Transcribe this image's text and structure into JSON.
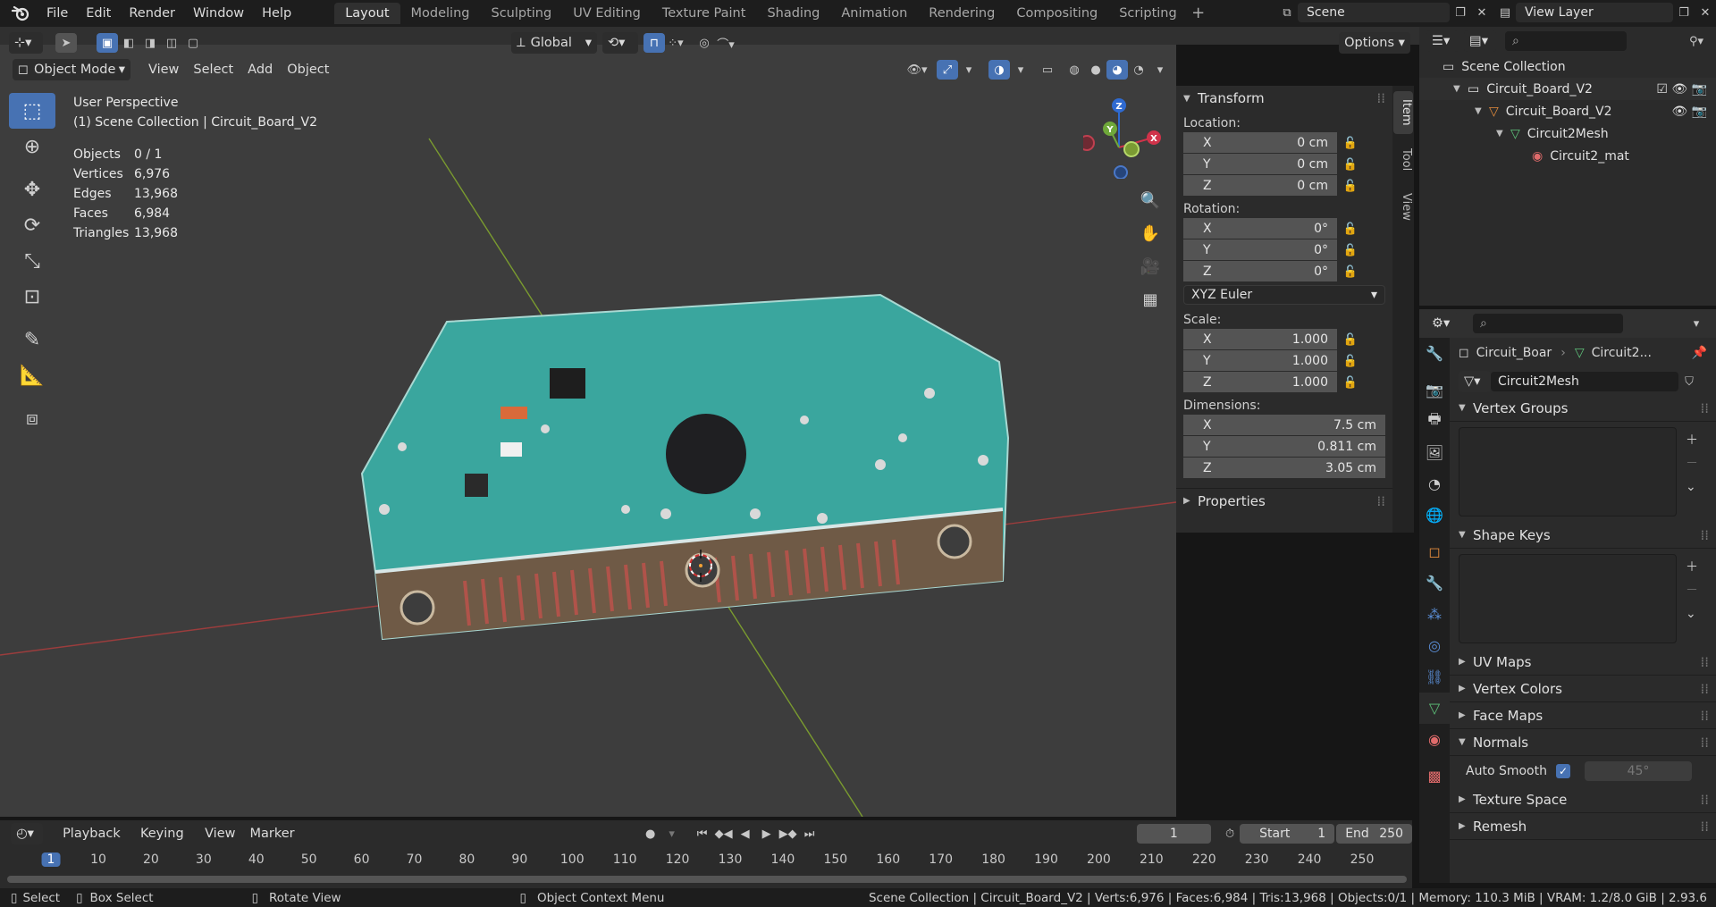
{
  "menus": [
    "File",
    "Edit",
    "Render",
    "Window",
    "Help"
  ],
  "workspaces": [
    "Layout",
    "Modeling",
    "Sculpting",
    "UV Editing",
    "Texture Paint",
    "Shading",
    "Animation",
    "Rendering",
    "Compositing",
    "Scripting"
  ],
  "scene": "Scene",
  "view_layer": "View Layer",
  "header": {
    "transform_orientation": "Global",
    "options": "Options",
    "mode": "Object Mode",
    "menus": [
      "View",
      "Select",
      "Add",
      "Object"
    ]
  },
  "viewport": {
    "perspective": "User Perspective",
    "collection": "(1) Scene Collection | Circuit_Board_V2",
    "stats": [
      {
        "label": "Objects",
        "value": "0 / 1"
      },
      {
        "label": "Vertices",
        "value": "6,976"
      },
      {
        "label": "Edges",
        "value": "13,968"
      },
      {
        "label": "Faces",
        "value": "6,984"
      },
      {
        "label": "Triangles",
        "value": "13,968"
      }
    ],
    "gizmo": {
      "z": "Z",
      "y": "Y",
      "x": "X"
    }
  },
  "npanel": {
    "transform": "Transform",
    "location": "Location:",
    "loc": [
      {
        "axis": "X",
        "value": "0 cm"
      },
      {
        "axis": "Y",
        "value": "0 cm"
      },
      {
        "axis": "Z",
        "value": "0 cm"
      }
    ],
    "rotation": "Rotation:",
    "rot": [
      {
        "axis": "X",
        "value": "0°"
      },
      {
        "axis": "Y",
        "value": "0°"
      },
      {
        "axis": "Z",
        "value": "0°"
      }
    ],
    "rot_mode": "XYZ Euler",
    "scale": "Scale:",
    "scl": [
      {
        "axis": "X",
        "value": "1.000"
      },
      {
        "axis": "Y",
        "value": "1.000"
      },
      {
        "axis": "Z",
        "value": "1.000"
      }
    ],
    "dimensions": "Dimensions:",
    "dim": [
      {
        "axis": "X",
        "value": "7.5 cm"
      },
      {
        "axis": "Y",
        "value": "0.811 cm"
      },
      {
        "axis": "Z",
        "value": "3.05 cm"
      }
    ],
    "properties": "Properties",
    "tabs": [
      "Item",
      "Tool",
      "View"
    ]
  },
  "outliner": {
    "root": "Scene Collection",
    "rows": [
      "Circuit_Board_V2",
      "Circuit_Board_V2",
      "Circuit2Mesh",
      "Circuit2_mat"
    ]
  },
  "properties": {
    "breadcrumb_obj": "Circuit_Boar",
    "breadcrumb_data": "Circuit2...",
    "mesh_name": "Circuit2Mesh",
    "sections": {
      "vertex_groups": "Vertex Groups",
      "shape_keys": "Shape Keys",
      "uv_maps": "UV Maps",
      "vertex_colors": "Vertex Colors",
      "face_maps": "Face Maps",
      "normals": "Normals",
      "texture_space": "Texture Space",
      "remesh": "Remesh"
    },
    "auto_smooth": "Auto Smooth",
    "angle": "45°"
  },
  "timeline": {
    "menus": [
      "Playback",
      "Keying",
      "View",
      "Marker"
    ],
    "current_frame": "1",
    "start_label": "Start",
    "start": "1",
    "end_label": "End",
    "end": "250",
    "frames": [
      "1",
      "10",
      "20",
      "30",
      "40",
      "50",
      "60",
      "70",
      "80",
      "90",
      "100",
      "110",
      "120",
      "130",
      "140",
      "150",
      "160",
      "170",
      "180",
      "190",
      "200",
      "210",
      "220",
      "230",
      "240",
      "250"
    ]
  },
  "status": {
    "select": "Select",
    "box_select": "Box Select",
    "rotate_view": "Rotate View",
    "context_menu": "Object Context Menu",
    "info": "Scene Collection | Circuit_Board_V2 | Verts:6,976 | Faces:6,984 | Tris:13,968 | Objects:0/1 | Memory: 110.3 MiB | VRAM: 1.2/8.0 GiB | 2.93.6"
  }
}
